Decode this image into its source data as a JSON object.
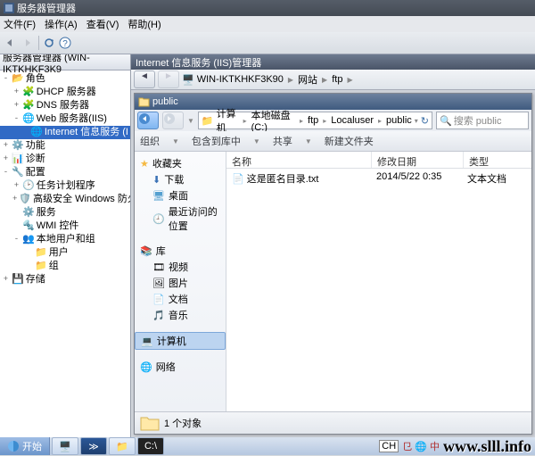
{
  "title": "服务器管理器",
  "menu": {
    "file": "文件(F)",
    "action": "操作(A)",
    "view": "查看(V)",
    "help": "帮助(H)"
  },
  "treeHdr": "服务器管理器 (WIN-IKTKHKF3K9",
  "roles": "角色",
  "dhcp": "DHCP 服务器",
  "dns": "DNS 服务器",
  "web": "Web 服务器(IIS)",
  "iisNode": "Internet 信息服务 (I",
  "features": "功能",
  "diag": "诊断",
  "config": "配置",
  "taskSched": "任务计划程序",
  "advFw": "高级安全 Windows 防火",
  "svc": "服务",
  "wmi": "WMI 控件",
  "localUG": "本地用户和组",
  "users": "用户",
  "groups": "组",
  "storage": "存储",
  "iisTitle": "Internet 信息服务 (IIS)管理器",
  "crumbHost": "WIN-IKTKHKF3K90",
  "crumbSites": "网站",
  "crumbFtp": "ftp",
  "expTitle": "public",
  "pathComputer": "计算机",
  "pathDisk": "本地磁盘 (C:)",
  "pathFtp": "ftp",
  "pathLU": "Localuser",
  "pathPub": "public",
  "searchPH": "搜索 public",
  "org": "组织",
  "lib": "包含到库中",
  "share": "共享",
  "newf": "新建文件夹",
  "favHdr": "收藏夹",
  "dl": "下载",
  "desk": "桌面",
  "recent": "最近访问的位置",
  "libHdr": "库",
  "vid": "视频",
  "pic": "图片",
  "doc": "文档",
  "mus": "音乐",
  "compHdr": "计算机",
  "netHdr": "网络",
  "colName": "名称",
  "colDate": "修改日期",
  "colType": "类型",
  "fName": "这是匿名目录.txt",
  "fDate": "2014/5/22 0:35",
  "fType": "文本文档",
  "objCount": "1 个对象",
  "startLabel": "开始",
  "ime": "CH",
  "cnFlag": "㔾 🌐 中",
  "watermark": "www.slll.info"
}
